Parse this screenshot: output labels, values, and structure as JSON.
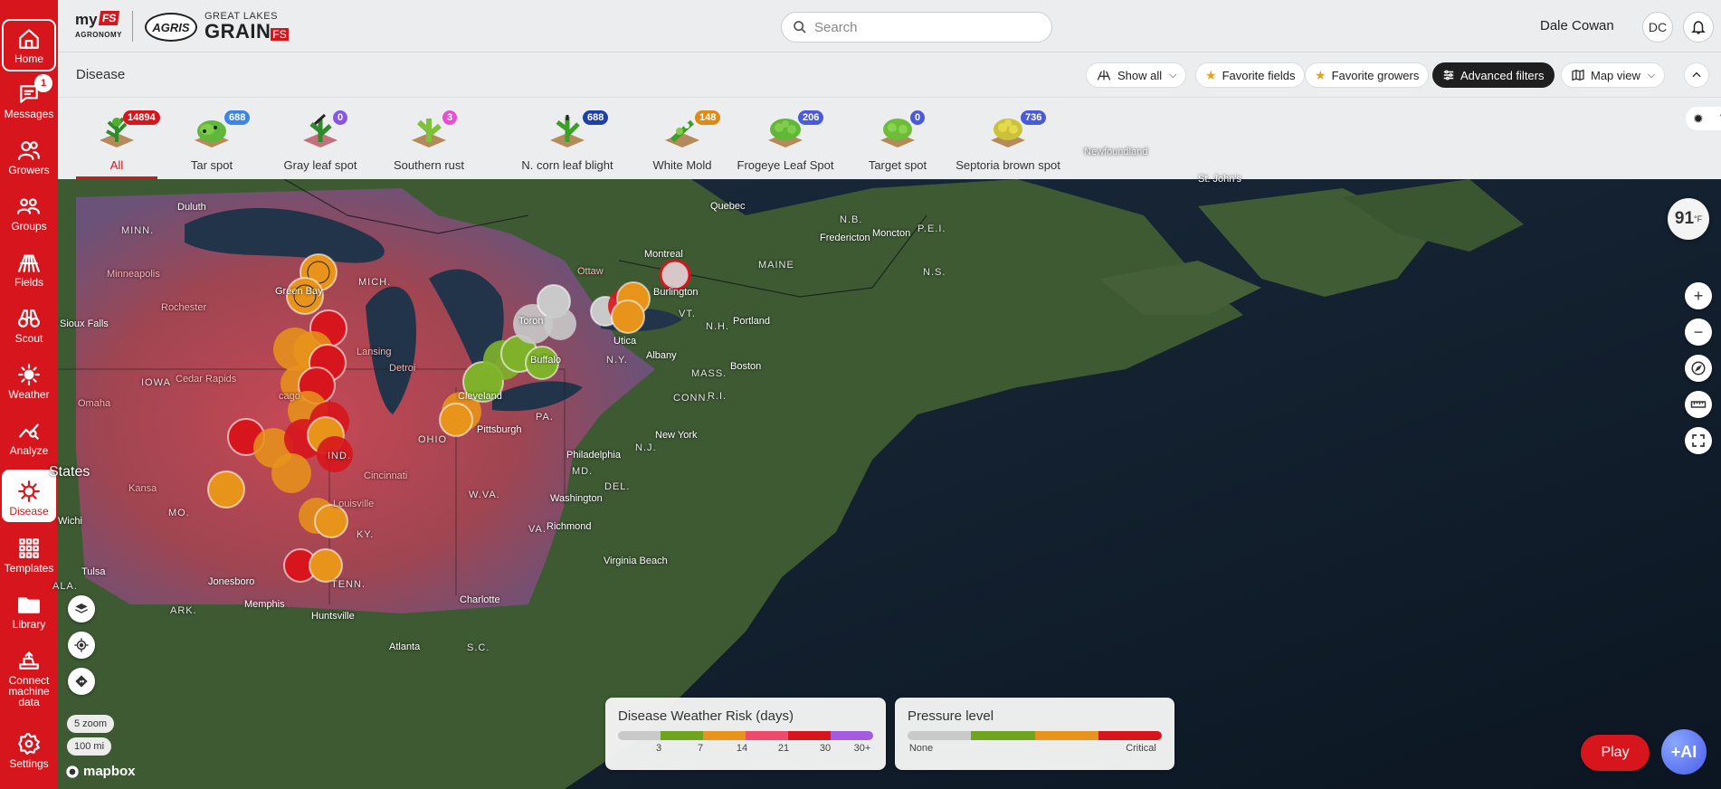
{
  "nav": {
    "messages_badge": "1",
    "items": [
      {
        "label": "Home",
        "icon": "home-icon"
      },
      {
        "label": "Messages",
        "icon": "chat-icon"
      },
      {
        "label": "Growers",
        "icon": "users-icon"
      },
      {
        "label": "Groups",
        "icon": "groups-icon"
      },
      {
        "label": "Fields",
        "icon": "fields-icon"
      },
      {
        "label": "Scout",
        "icon": "binoculars-icon"
      },
      {
        "label": "Weather",
        "icon": "sun-icon"
      },
      {
        "label": "Analyze",
        "icon": "analyze-icon"
      },
      {
        "label": "Disease",
        "icon": "virus-icon"
      },
      {
        "label": "Templates",
        "icon": "grid-icon"
      },
      {
        "label": "Library",
        "icon": "folder-icon"
      },
      {
        "label": "Connect machine data",
        "icon": "tractor-icon"
      },
      {
        "label": "Settings",
        "icon": "gear-icon"
      }
    ]
  },
  "header": {
    "logo_my": "my",
    "logo_fs": "FS",
    "logo_agronomy": "AGRONOMY",
    "logo_agris": "AGRIS",
    "logo_great_lakes": "GREAT LAKES",
    "logo_grain": "GRAIN",
    "search_placeholder": "Search",
    "user_name": "Dale Cowan",
    "user_initials": "DC"
  },
  "filters": {
    "page_title": "Disease",
    "show_all": "Show all",
    "favorite_fields": "Favorite fields",
    "favorite_growers": "Favorite growers",
    "advanced_filters": "Advanced filters",
    "map_view": "Map view"
  },
  "tabs": [
    {
      "label": "All",
      "count": "14894",
      "color": "#d7151d"
    },
    {
      "label": "Tar spot",
      "count": "688",
      "color": "#3a86e8"
    },
    {
      "label": "Gray leaf spot",
      "count": "0",
      "color": "#8a55e0"
    },
    {
      "label": "Southern rust",
      "count": "3",
      "color": "#e84fd0"
    },
    {
      "label": "N. corn leaf blight",
      "count": "688",
      "color": "#1d3fa8"
    },
    {
      "label": "White Mold",
      "count": "148",
      "color": "#e08a14"
    },
    {
      "label": "Frogeye Leaf Spot",
      "count": "206",
      "color": "#4b5ad8"
    },
    {
      "label": "Target spot",
      "count": "0",
      "color": "#4b5ad8"
    },
    {
      "label": "Septoria brown spot",
      "count": "736",
      "color": "#4b5ad8"
    }
  ],
  "map": {
    "temperature": "91",
    "temperature_unit": "°F",
    "zoom_label": "5 zoom",
    "scale_label": "100 mi",
    "attribution": "mapbox",
    "labels": {
      "newfoundland": "Newfoundland",
      "st_johns": "St. John's",
      "quebec": "Quebec",
      "nb": "N.B.",
      "fredericton": "Fredericton",
      "moncton": "Moncton",
      "pei": "P.E.I.",
      "ns": "N.S.",
      "maine": "MAINE",
      "montreal": "Montreal",
      "ottawa": "Ottaw",
      "burlington": "Burlington",
      "vt": "VT.",
      "nh": "N.H.",
      "portland": "Portland",
      "utica": "Utica",
      "ny": "N.Y.",
      "albany": "Albany",
      "mass": "MASS.",
      "boston": "Boston",
      "conn": "CONN.",
      "ri": "R.I.",
      "buffalo": "Buffalo",
      "toronto": "Toron",
      "cleveland": "Cleveland",
      "pittsburgh": "Pittsburgh",
      "pa": "PA.",
      "new_york": "New York",
      "nj": "N.J.",
      "philadelphia": "Philadelphia",
      "md": "MD.",
      "del": "DEL.",
      "washington": "Washington",
      "wva": "W.VA.",
      "va": "VA.",
      "richmond": "Richmond",
      "virginia_beach": "Virginia Beach",
      "charlotte": "Charlotte",
      "sc": "S.C.",
      "atlanta": "Atlanta",
      "tenn": "TENN.",
      "huntsville": "Huntsville",
      "memphis": "Memphis",
      "ark": "ARK.",
      "jonesboro": "Jonesboro",
      "tulsa": "Tulsa",
      "ky": "KY.",
      "louisville": "Louisville",
      "cincinnati": "Cincinnati",
      "ind": "IND.",
      "ohio": "OHIO",
      "detroit": "Detroi",
      "lansing": "Lansing",
      "mich": "MICH.",
      "green_bay": "Green Bay",
      "chicago": "cago",
      "iowa": "IOWA",
      "cedar_rapids": "Cedar Rapids",
      "omaha": "Omaha",
      "sioux_falls": "Sioux Falls",
      "rochester": "Rochester",
      "minneapolis": "Minneapolis",
      "minn": "MINN.",
      "duluth": "Duluth",
      "kansas": "Kansa",
      "mo": "MO.",
      "states": "States",
      "wichita": "Wichi",
      "ala": "ALA."
    }
  },
  "legends": {
    "risk": {
      "title": "Disease Weather Risk (days)",
      "ticks": [
        "3",
        "7",
        "14",
        "21",
        "30",
        "30+"
      ],
      "colors": [
        "#c9c9c9",
        "#6fa51e",
        "#e8941a",
        "#ef4a6b",
        "#d7151d",
        "#a55be0"
      ]
    },
    "pressure": {
      "title": "Pressure level",
      "min_label": "None",
      "max_label": "Critical",
      "colors": [
        "#c9c9c9",
        "#6fa51e",
        "#e8941a",
        "#d7151d"
      ]
    }
  },
  "actions": {
    "play": "Play",
    "ai": "+AI"
  }
}
